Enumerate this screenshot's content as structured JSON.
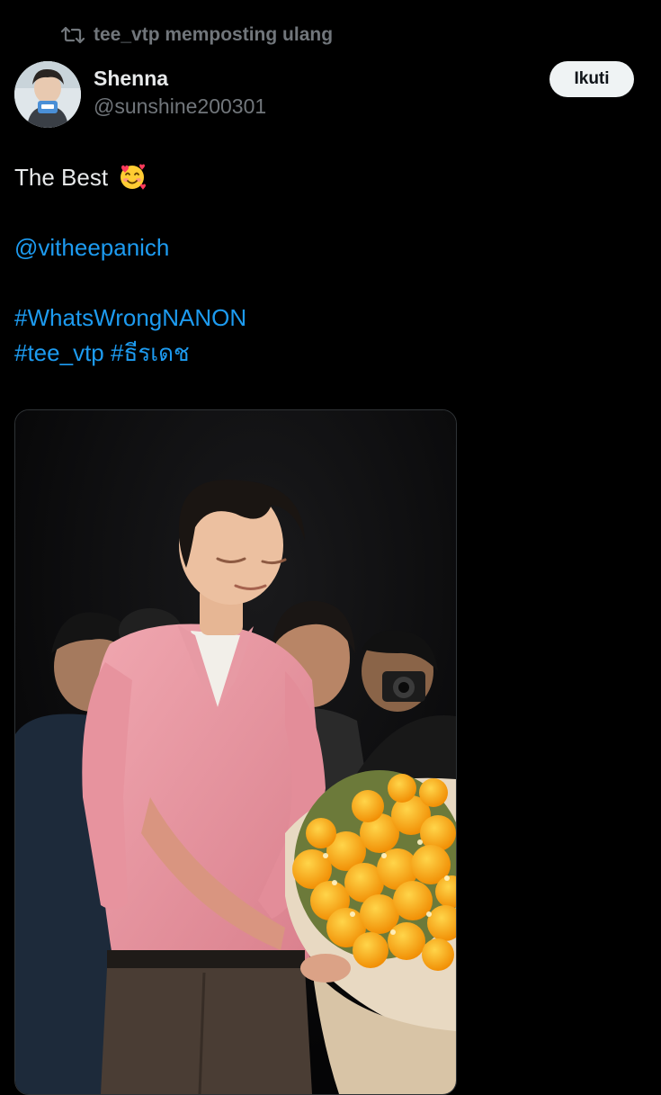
{
  "repost": {
    "text": "tee_vtp memposting ulang",
    "icon": "repost-icon"
  },
  "author": {
    "display_name": "Shenna",
    "handle": "@sunshine200301",
    "avatar_icon": "avatar"
  },
  "follow_label": "Ikuti",
  "tweet": {
    "line1": "The Best",
    "emoji": "smiling-face-with-hearts-emoji",
    "mention": "@vitheepanich",
    "hashtag1": "#WhatsWrongNANON",
    "hashtag2": "#tee_vtp",
    "hashtag3": "#ธีรเดช"
  },
  "colors": {
    "background": "#000000",
    "link": "#1d9bf0",
    "muted": "#71767b",
    "text": "#e7e9ea",
    "follow_bg": "#eff3f4"
  },
  "media": {
    "kind": "photo",
    "subject": "man in pink shirt holding yellow rose bouquet"
  }
}
